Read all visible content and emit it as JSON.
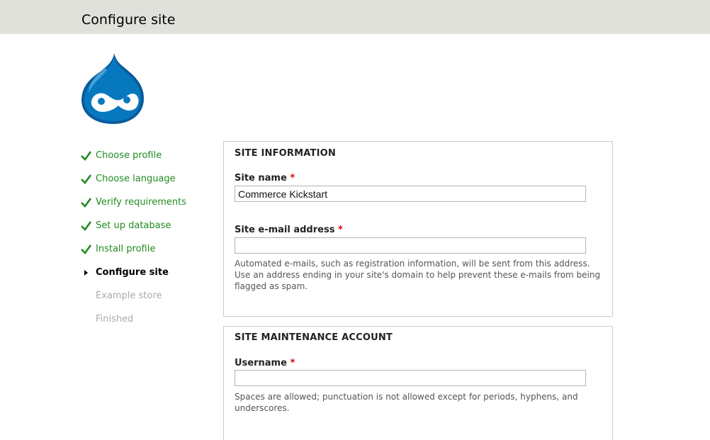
{
  "header": {
    "title": "Configure site"
  },
  "logo": {
    "icon": "drupal-drop-logo",
    "color": "#0678be"
  },
  "steps": [
    {
      "label": "Choose profile",
      "state": "done",
      "icon": "checkmark-icon"
    },
    {
      "label": "Choose language",
      "state": "done",
      "icon": "checkmark-icon"
    },
    {
      "label": "Verify requirements",
      "state": "done",
      "icon": "checkmark-icon"
    },
    {
      "label": "Set up database",
      "state": "done",
      "icon": "checkmark-icon"
    },
    {
      "label": "Install profile",
      "state": "done",
      "icon": "checkmark-icon"
    },
    {
      "label": "Configure site",
      "state": "active",
      "icon": "triangle-right-icon"
    },
    {
      "label": "Example store",
      "state": "pending"
    },
    {
      "label": "Finished",
      "state": "pending"
    }
  ],
  "site_information": {
    "legend": "SITE INFORMATION",
    "site_name": {
      "label": "Site name",
      "required_marker": "*",
      "value": "Commerce Kickstart"
    },
    "site_email": {
      "label": "Site e-mail address",
      "required_marker": "*",
      "value": "",
      "description": "Automated e-mails, such as registration information, will be sent from this address. Use an address ending in your site's domain to help prevent these e-mails from being flagged as spam."
    }
  },
  "site_maintenance_account": {
    "legend": "SITE MAINTENANCE ACCOUNT",
    "username": {
      "label": "Username",
      "required_marker": "*",
      "value": "",
      "description": "Spaces are allowed; punctuation is not allowed except for periods, hyphens, and underscores."
    }
  },
  "colors": {
    "header_bg": "#e1e1dc",
    "step_done": "#228b22",
    "step_pending": "#aaaaaa",
    "required": "#e00000"
  }
}
